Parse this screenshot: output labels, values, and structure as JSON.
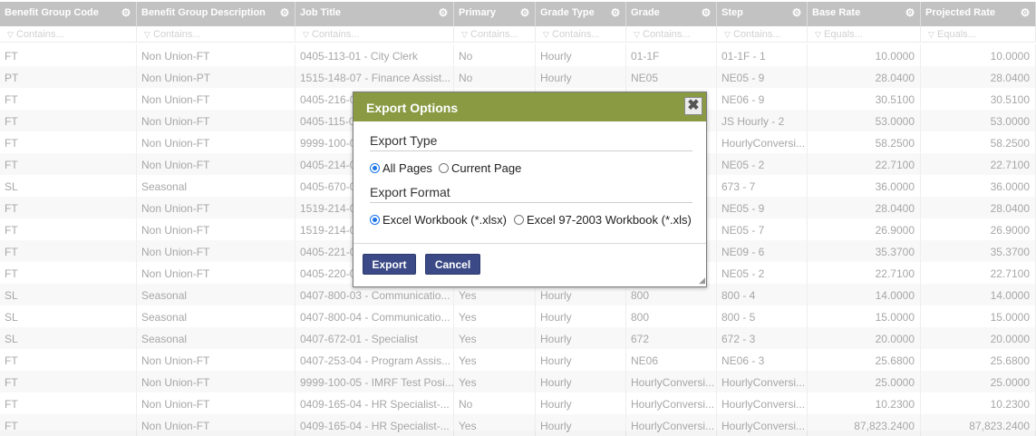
{
  "columns": [
    {
      "label": "Benefit Group Code",
      "filter": "Contains..."
    },
    {
      "label": "Benefit Group Description",
      "filter": "Contains..."
    },
    {
      "label": "Job Title",
      "filter": "Contains..."
    },
    {
      "label": "Primary",
      "filter": "Contains..."
    },
    {
      "label": "Grade Type",
      "filter": "Contains..."
    },
    {
      "label": "Grade",
      "filter": "Contains..."
    },
    {
      "label": "Step",
      "filter": "Contains..."
    },
    {
      "label": "Base Rate",
      "filter": "Equals..."
    },
    {
      "label": "Projected Rate",
      "filter": "Equals..."
    }
  ],
  "rows": [
    [
      "FT",
      "Non Union-FT",
      "0405-113-01 - City Clerk",
      "No",
      "Hourly",
      "01-1F",
      "01-1F - 1",
      "10.0000",
      "10.0000"
    ],
    [
      "PT",
      "Non Union-PT",
      "1515-148-07 - Finance Assist...",
      "No",
      "Hourly",
      "NE05",
      "NE05 - 9",
      "28.0400",
      "28.0400"
    ],
    [
      "FT",
      "Non Union-FT",
      "0405-216-0",
      "",
      "",
      "",
      "NE06 - 9",
      "30.5100",
      "30.5100"
    ],
    [
      "FT",
      "Non Union-FT",
      "0405-115-0",
      "",
      "",
      "",
      "JS Hourly - 2",
      "53.0000",
      "53.0000"
    ],
    [
      "FT",
      "Non Union-FT",
      "9999-100-0",
      "",
      "",
      "",
      "HourlyConversi...",
      "58.2500",
      "58.2500"
    ],
    [
      "FT",
      "Non Union-FT",
      "0405-214-0",
      "",
      "",
      "",
      "NE05 - 2",
      "22.7100",
      "22.7100"
    ],
    [
      "SL",
      "Seasonal",
      "0405-670-0",
      "",
      "",
      "",
      "673 - 7",
      "36.0000",
      "36.0000"
    ],
    [
      "FT",
      "Non Union-FT",
      "1519-214-0",
      "",
      "",
      "",
      "NE05 - 9",
      "28.0400",
      "28.0400"
    ],
    [
      "FT",
      "Non Union-FT",
      "1519-214-0",
      "",
      "",
      "",
      "NE05 - 7",
      "26.9000",
      "26.9000"
    ],
    [
      "FT",
      "Non Union-FT",
      "0405-221-0",
      "",
      "",
      "",
      "NE09 - 6",
      "35.3700",
      "35.3700"
    ],
    [
      "FT",
      "Non Union-FT",
      "0405-220-0",
      "",
      "",
      "",
      "NE05 - 2",
      "22.7100",
      "22.7100"
    ],
    [
      "SL",
      "Seasonal",
      "0407-800-03 - Communicatio...",
      "Yes",
      "Hourly",
      "800",
      "800 - 4",
      "14.0000",
      "14.0000"
    ],
    [
      "SL",
      "Seasonal",
      "0407-800-04 - Communicatio...",
      "Yes",
      "Hourly",
      "800",
      "800 - 5",
      "15.0000",
      "15.0000"
    ],
    [
      "SL",
      "Seasonal",
      "0407-672-01 - Specialist",
      "Yes",
      "Hourly",
      "672",
      "672 - 3",
      "20.0000",
      "20.0000"
    ],
    [
      "FT",
      "Non Union-FT",
      "0407-253-04 - Program Assis...",
      "Yes",
      "Hourly",
      "NE06",
      "NE06 - 3",
      "25.6800",
      "25.6800"
    ],
    [
      "FT",
      "Non Union-FT",
      "9999-100-05 - IMRF Test Posi...",
      "Yes",
      "Hourly",
      "HourlyConversi...",
      "HourlyConversi...",
      "25.0000",
      "25.0000"
    ],
    [
      "FT",
      "Non Union-FT",
      "0409-165-04 - HR Specialist-...",
      "No",
      "Hourly",
      "HourlyConversi...",
      "HourlyConversi...",
      "10.2300",
      "10.2300"
    ],
    [
      "FT",
      "Non Union-FT",
      "0409-165-04 - HR Specialist-...",
      "Yes",
      "Hourly",
      "HourlyConversi...",
      "HourlyConversi...",
      "87,823.2400",
      "87,823.2400"
    ]
  ],
  "dialog": {
    "title": "Export Options",
    "close_glyph": "✖",
    "export_type_heading": "Export Type",
    "type_options": [
      {
        "label": "All Pages",
        "selected": true
      },
      {
        "label": "Current Page",
        "selected": false
      }
    ],
    "export_format_heading": "Export Format",
    "format_options": [
      {
        "label": "Excel Workbook (*.xlsx)",
        "selected": true
      },
      {
        "label": "Excel 97-2003 Workbook (*.xls)",
        "selected": false
      }
    ],
    "export_button": "Export",
    "cancel_button": "Cancel"
  },
  "icons": {
    "gear": "gear-icon",
    "filter": "filter-icon",
    "close": "close-icon",
    "resize": "resize-grip-icon"
  },
  "colors": {
    "header_bg": "#a1a1a1",
    "dialog_title_bg": "#8a9a43",
    "button_bg": "#3b4a86",
    "radio_selected": "#1a73e8"
  }
}
